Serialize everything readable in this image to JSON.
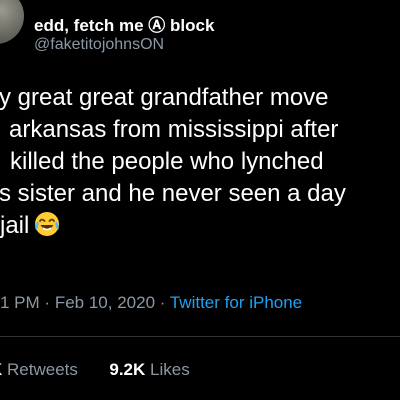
{
  "author": {
    "display_name": "edd, fetch me Ⓐ block",
    "handle": "@faketitojohnsON"
  },
  "tweet": {
    "lines": [
      "y great great grandfather move",
      "arkansas from mississippi after",
      "killed the people who lynched",
      "s sister and he never seen a day",
      "jail"
    ],
    "emoji": "face-with-tears-of-joy"
  },
  "meta": {
    "time": "1 PM",
    "separator": "·",
    "date": "Feb 10, 2020",
    "source": "Twitter for iPhone"
  },
  "stats": {
    "retweets_count": "K",
    "retweets_label": "Retweets",
    "likes_count": "9.2K",
    "likes_label": "Likes"
  },
  "colors": {
    "background": "#000000",
    "primary_text": "#ffffff",
    "secondary_text": "#8b98a5",
    "link": "#1da1f2",
    "divider": "#2f3336"
  }
}
